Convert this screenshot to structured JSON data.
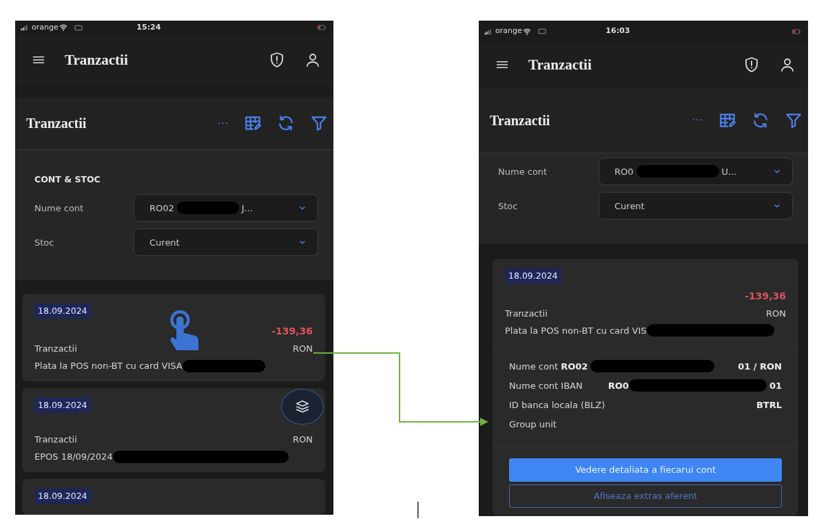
{
  "screens": [
    {
      "status_bar": {
        "carrier": "orange",
        "time": "15:24"
      },
      "app_bar": {
        "title": "Tranzactii"
      },
      "panel": {
        "title": "Tranzactii",
        "more": "···"
      },
      "filters": {
        "section_title": "CONT & STOC",
        "fields": [
          {
            "label": "Nume cont",
            "value_start": "RO02",
            "value_end": "J...",
            "redacted": true
          },
          {
            "label": "Stoc",
            "value_start": "Curent",
            "redacted": false
          }
        ]
      },
      "transactions": [
        {
          "date": "18.09.2024",
          "amount": "-139,36",
          "type": "Tranzactii",
          "currency": "RON",
          "description": "Plata la POS non-BT cu card VISA",
          "redacted": true,
          "touched": true,
          "expanded": false
        },
        {
          "date": "18.09.2024",
          "type": "Tranzactii",
          "currency": "RON",
          "description": "EPOS 18/09/2024",
          "redacted": true,
          "touched": false,
          "expanded": false
        },
        {
          "date": "18.09.2024",
          "touched": false,
          "expanded": false
        }
      ],
      "layers_button": true
    },
    {
      "status_bar": {
        "carrier": "orange",
        "time": "16:03"
      },
      "app_bar": {
        "title": "Tranzactii"
      },
      "panel": {
        "title": "Tranzactii",
        "more": "···"
      },
      "filters": {
        "fields": [
          {
            "label": "Nume cont",
            "value_start": "RO0",
            "value_end": "U...",
            "redacted": true
          },
          {
            "label": "Stoc",
            "value_start": "Curent",
            "redacted": false
          }
        ]
      },
      "transactions": [
        {
          "date": "18.09.2024",
          "amount": "-139,36",
          "type": "Tranzactii",
          "currency": "RON",
          "description": "Plata la POS non-BT cu card VIS",
          "redacted": true,
          "touched": false,
          "expanded": true,
          "details": [
            {
              "label": "Nume cont",
              "value_start": "RO02",
              "value_end": "01 / RON",
              "redacted": true,
              "joined": true
            },
            {
              "label": "Nume cont IBAN",
              "value_start": "RO0",
              "value_end": "01",
              "redacted": true,
              "joined": false
            },
            {
              "label": "ID banca locala (BLZ)",
              "value_end": "BTRL",
              "redacted": false
            },
            {
              "label": "Group unit",
              "redacted": false
            }
          ],
          "buttons": [
            {
              "label": "Vedere detaliata a fiecarui cont",
              "kind": "primary"
            },
            {
              "label": "Afiseaza extras aferent",
              "kind": "outline"
            }
          ]
        }
      ],
      "layers_button": false
    }
  ]
}
